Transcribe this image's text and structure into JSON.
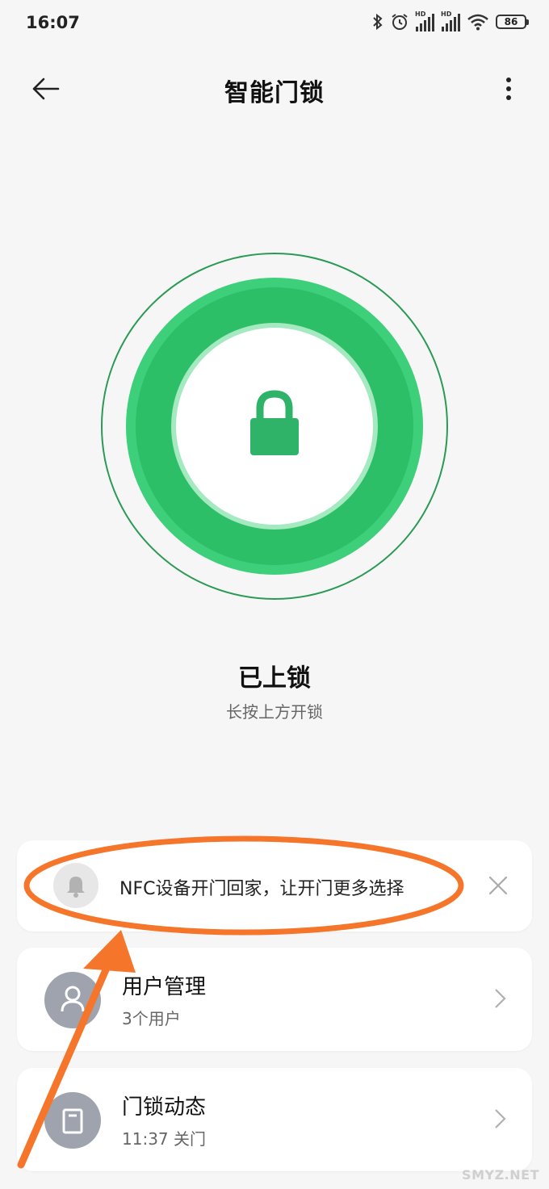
{
  "status_bar": {
    "time": "16:07",
    "hd_label_1": "HD",
    "hd_label_2": "HD",
    "battery": "86",
    "icons": [
      "bluetooth-icon",
      "alarm-icon",
      "signal-icon",
      "signal-icon",
      "wifi-icon",
      "battery-icon"
    ]
  },
  "header": {
    "title": "智能门锁",
    "back_icon": "arrow-left-icon",
    "more_icon": "more-vertical-icon"
  },
  "lock": {
    "status": "已上锁",
    "hint": "长按上方开锁",
    "icon": "lock-icon",
    "accent_color": "#2fc36d"
  },
  "notice": {
    "text": "NFC设备开门回家，让开门更多选择",
    "icon": "bell-icon",
    "close_icon": "close-icon"
  },
  "menu": {
    "users": {
      "title": "用户管理",
      "subtitle": "3个用户",
      "icon": "user-icon"
    },
    "log": {
      "title": "门锁动态",
      "subtitle": "11:37 关门",
      "icon": "document-icon"
    }
  },
  "annotation_color": "#f5762a",
  "watermark": "SMYZ.NET"
}
